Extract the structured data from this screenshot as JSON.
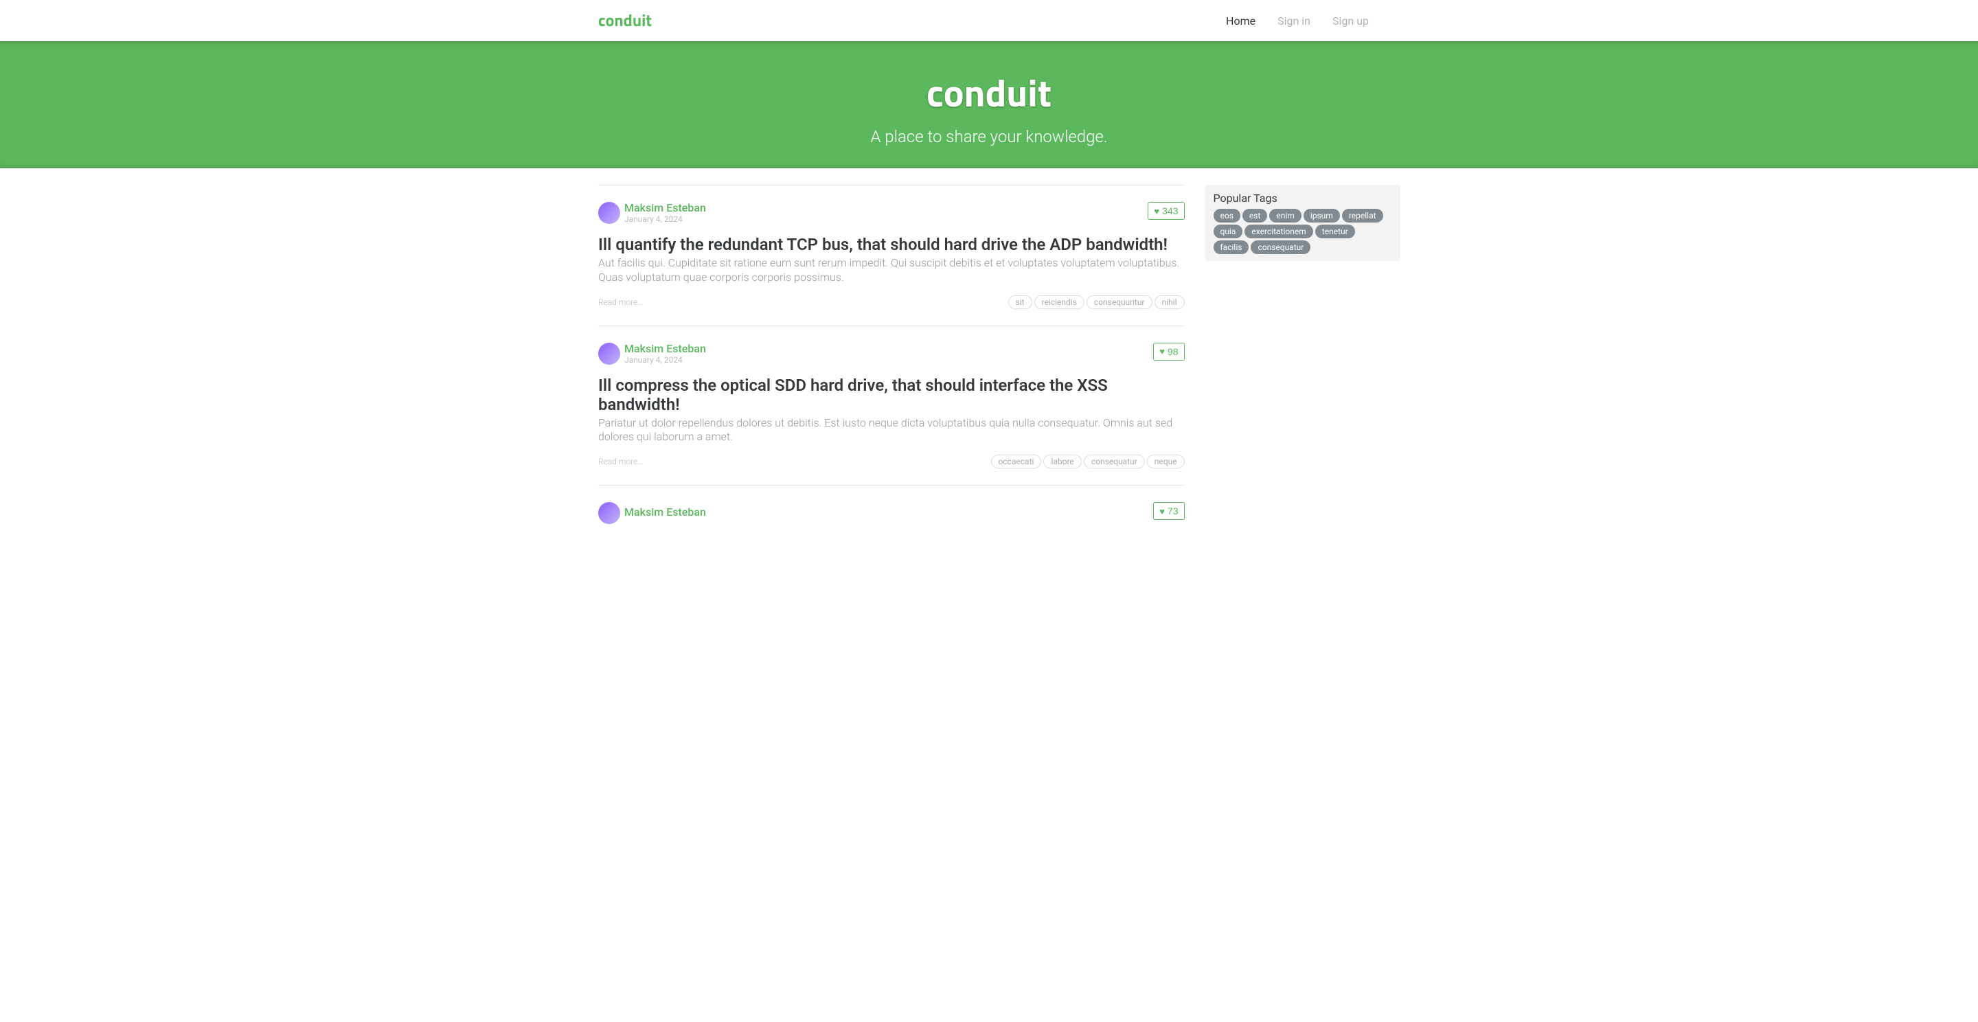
{
  "brand": "conduit",
  "nav": {
    "home": "Home",
    "signin": "Sign in",
    "signup": "Sign up"
  },
  "banner": {
    "title": "conduit",
    "subtitle": "A place to share your knowledge."
  },
  "sidebar": {
    "title": "Popular Tags",
    "tags": [
      "eos",
      "est",
      "enim",
      "ipsum",
      "repellat",
      "quia",
      "exercitationem",
      "tenetur",
      "facilis",
      "consequatur"
    ]
  },
  "articles": [
    {
      "author": "Maksim Esteban",
      "date": "January 4, 2024",
      "likes": "343",
      "title": "Ill quantify the redundant TCP bus, that should hard drive the ADP bandwidth!",
      "description": "Aut facilis qui. Cupiditate sit ratione eum sunt rerum impedit. Qui suscipit debitis et et voluptates voluptatem voluptatibus. Quas voluptatum quae corporis corporis possimus.",
      "readmore": "Read more...",
      "tags": [
        "sit",
        "reiciendis",
        "consequuntur",
        "nihil"
      ]
    },
    {
      "author": "Maksim Esteban",
      "date": "January 4, 2024",
      "likes": "98",
      "title": "Ill compress the optical SDD hard drive, that should interface the XSS bandwidth!",
      "description": "Pariatur ut dolor repellendus dolores ut debitis. Est iusto neque dicta voluptatibus quia nulla consequatur. Omnis aut sed dolores qui laborum a amet.",
      "readmore": "Read more...",
      "tags": [
        "occaecati",
        "labore",
        "consequatur",
        "neque"
      ]
    },
    {
      "author": "Maksim Esteban",
      "date": "",
      "likes": "73",
      "title": "",
      "description": "",
      "readmore": "",
      "tags": []
    }
  ]
}
